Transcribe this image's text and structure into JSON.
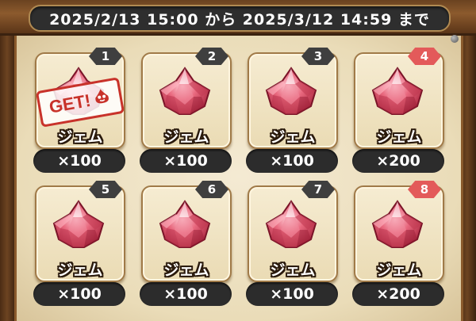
{
  "event_period": "2025/2/13 15:00 から 2025/3/12 14:59 まで",
  "stamp_text": "GET!",
  "colors": {
    "badge_normal": "#3f3f3f",
    "badge_special": "#e35a5a",
    "gem": "#e0506a",
    "stamp": "#c8322a"
  },
  "rewards": [
    {
      "number": "1",
      "name": "ジェム",
      "quantity": "×100",
      "special": false,
      "obtained": true,
      "icon": "gem-icon"
    },
    {
      "number": "2",
      "name": "ジェム",
      "quantity": "×100",
      "special": false,
      "obtained": false,
      "icon": "gem-icon"
    },
    {
      "number": "3",
      "name": "ジェム",
      "quantity": "×100",
      "special": false,
      "obtained": false,
      "icon": "gem-icon"
    },
    {
      "number": "4",
      "name": "ジェム",
      "quantity": "×200",
      "special": true,
      "obtained": false,
      "icon": "gem-icon"
    },
    {
      "number": "5",
      "name": "ジェム",
      "quantity": "×100",
      "special": false,
      "obtained": false,
      "icon": "gem-icon"
    },
    {
      "number": "6",
      "name": "ジェム",
      "quantity": "×100",
      "special": false,
      "obtained": false,
      "icon": "gem-icon"
    },
    {
      "number": "7",
      "name": "ジェム",
      "quantity": "×100",
      "special": false,
      "obtained": false,
      "icon": "gem-icon"
    },
    {
      "number": "8",
      "name": "ジェム",
      "quantity": "×200",
      "special": true,
      "obtained": false,
      "icon": "gem-icon"
    }
  ]
}
